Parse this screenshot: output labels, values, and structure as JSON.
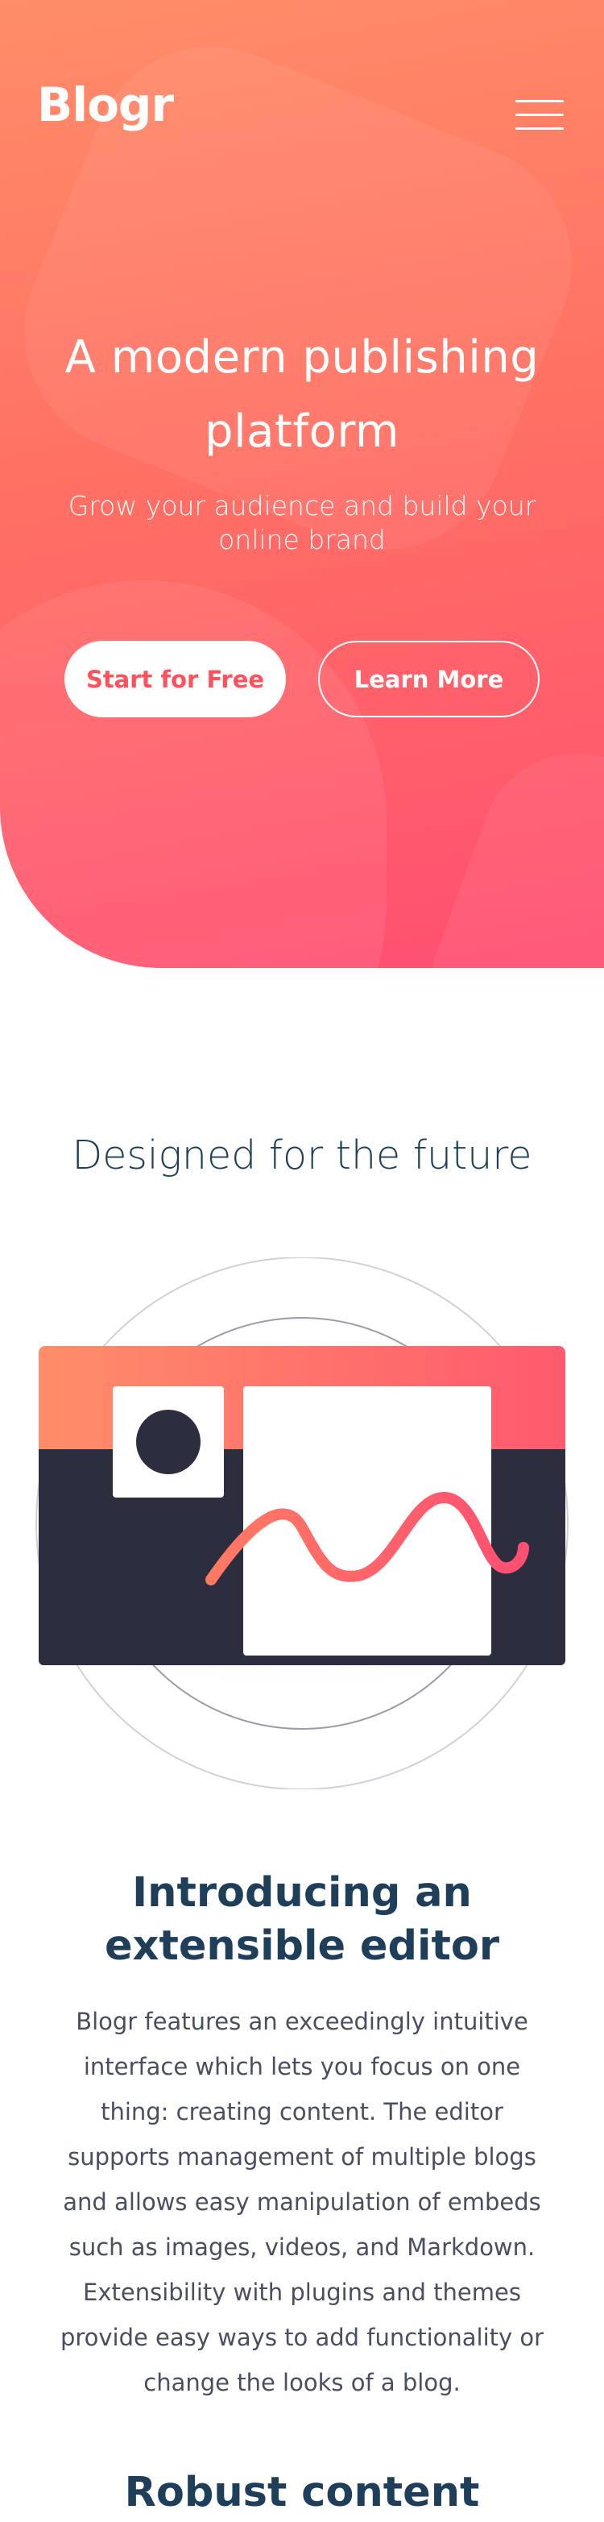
{
  "header": {
    "logo": "Blogr",
    "menu_icon": "hamburger-menu-icon"
  },
  "hero": {
    "title": "A modern publishing platform",
    "subtitle": "Grow your audience and build your online brand",
    "primary_button": "Start for Free",
    "secondary_button": "Learn More"
  },
  "features": {
    "section_title": "Designed for the future",
    "editor_title": "Introducing an extensible editor",
    "editor_body": "Blogr features an exceedingly intuitive interface which lets you focus on one thing: creating content. The editor supports management of multiple blogs and allows easy manipulation of embeds such as images, videos, and Markdown. Extensibility with plugins and themes provide easy ways to add functionality or change the looks of a blog.",
    "next_title": "Robust content"
  },
  "colors": {
    "hero_start": "#ff8d69",
    "hero_end": "#ff4f72",
    "heading": "#1f3e5a",
    "body_text": "#4a4e61",
    "illustration_dark": "#2c2e40"
  }
}
